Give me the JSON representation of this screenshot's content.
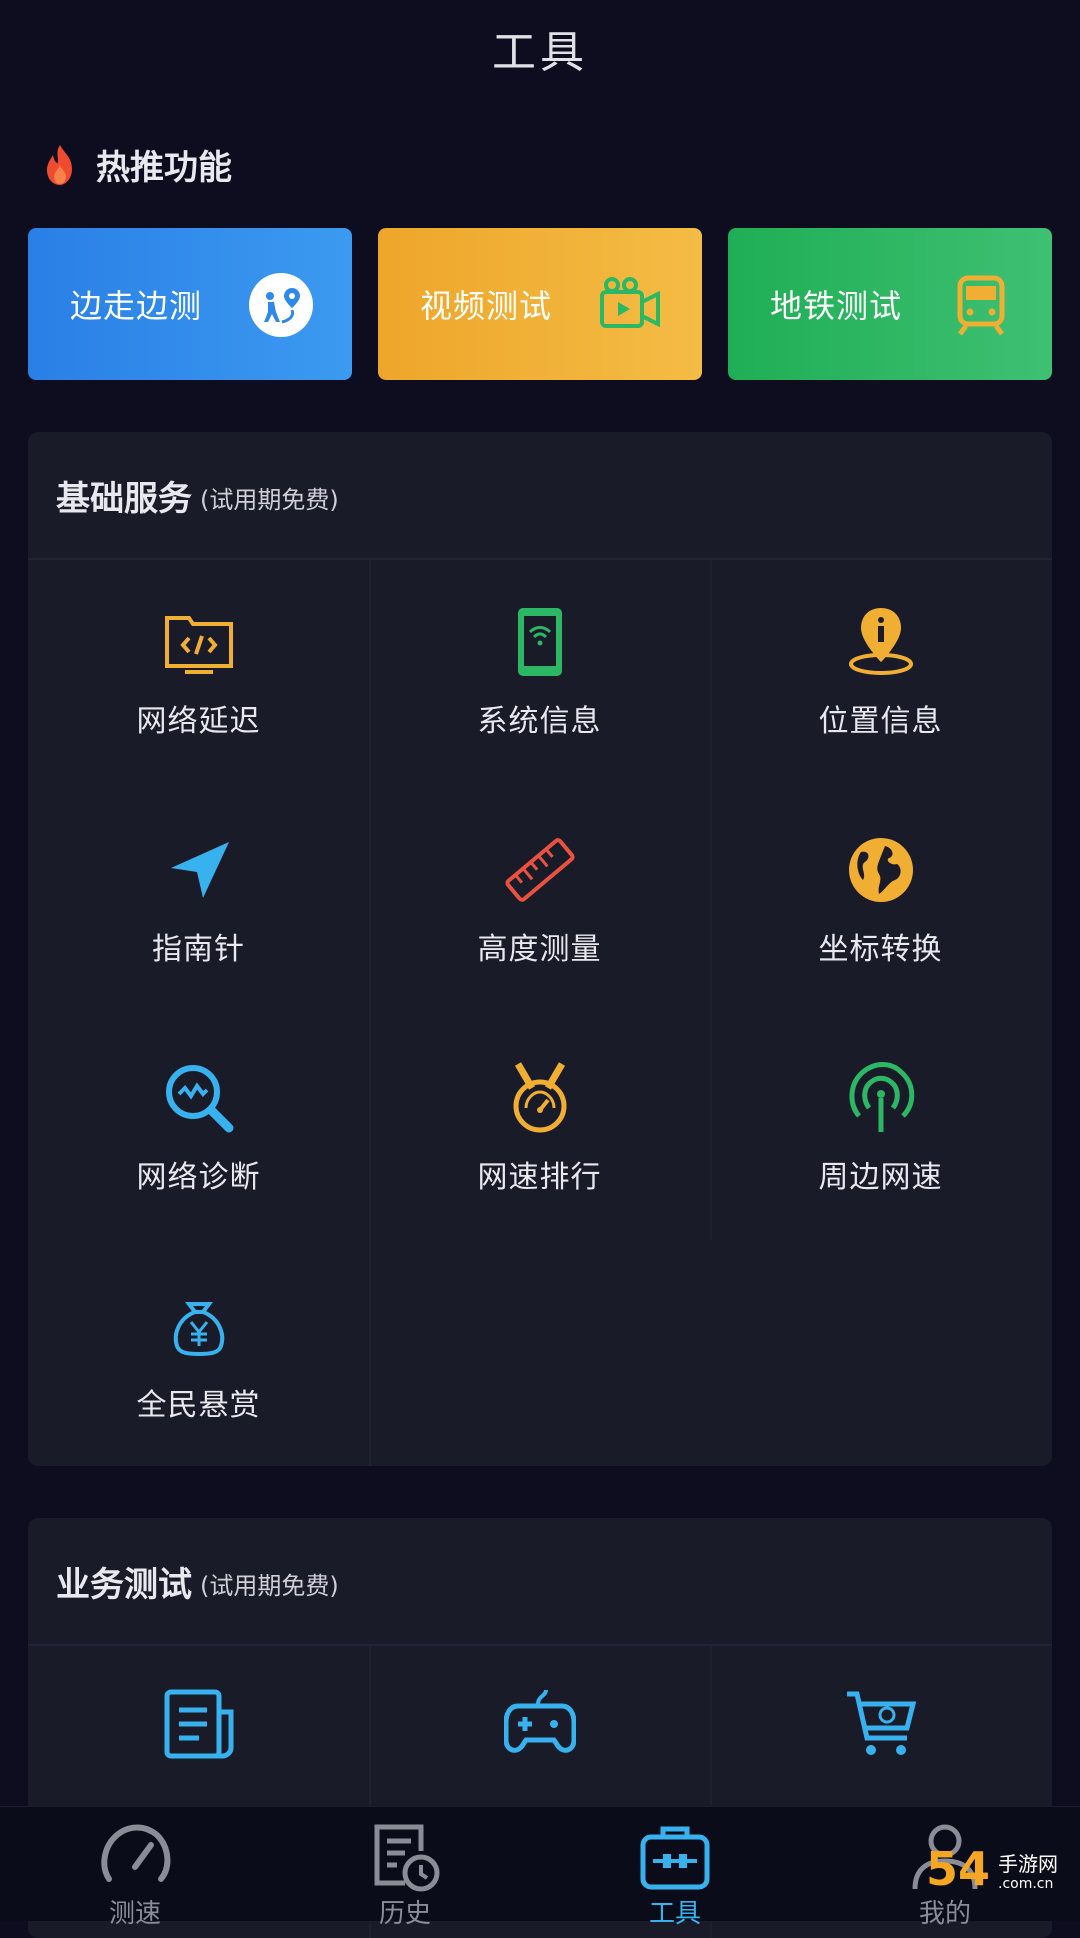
{
  "header": {
    "title": "工具"
  },
  "hot": {
    "title": "热推功能",
    "cards": [
      {
        "label": "边走边测",
        "icon": "walking-route-icon",
        "color": "#2f88ea"
      },
      {
        "label": "视频测试",
        "icon": "video-camera-icon",
        "color": "#f0ae33"
      },
      {
        "label": "地铁测试",
        "icon": "subway-train-icon",
        "color": "#2bb764"
      }
    ]
  },
  "basic": {
    "title": "基础服务",
    "subtitle": "(试用期免费)",
    "items": [
      {
        "label": "网络延迟",
        "icon": "code-folder-icon"
      },
      {
        "label": "系统信息",
        "icon": "phone-wifi-icon"
      },
      {
        "label": "位置信息",
        "icon": "location-info-icon"
      },
      {
        "label": "指南针",
        "icon": "compass-arrow-icon"
      },
      {
        "label": "高度测量",
        "icon": "ruler-icon"
      },
      {
        "label": "坐标转换",
        "icon": "globe-icon"
      },
      {
        "label": "网络诊断",
        "icon": "magnifier-wave-icon"
      },
      {
        "label": "网速排行",
        "icon": "medal-speedometer-icon"
      },
      {
        "label": "周边网速",
        "icon": "signal-broadcast-icon"
      },
      {
        "label": "全民悬赏",
        "icon": "money-bag-icon"
      }
    ]
  },
  "business": {
    "title": "业务测试",
    "subtitle": "(试用期免费)",
    "items": [
      {
        "icon": "document-icon"
      },
      {
        "icon": "gamepad-icon"
      },
      {
        "icon": "shopping-cart-icon"
      }
    ]
  },
  "tabbar": {
    "tabs": [
      {
        "label": "测速",
        "icon": "speedometer-icon"
      },
      {
        "label": "历史",
        "icon": "history-document-icon"
      },
      {
        "label": "工具",
        "icon": "toolbox-icon",
        "active": true
      },
      {
        "label": "我的",
        "icon": "user-icon"
      }
    ]
  },
  "watermark": {
    "number": "54",
    "site": "手游网",
    "domain": ".com.cn"
  },
  "colors": {
    "accent": "#38b2ee",
    "orange": "#f0ae33",
    "green": "#2bb764",
    "red": "#e8523f"
  }
}
